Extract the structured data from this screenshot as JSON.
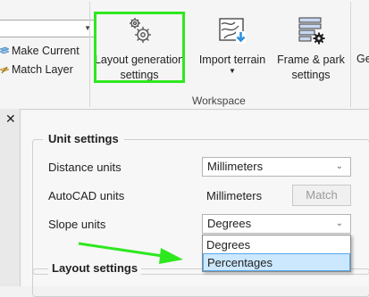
{
  "ribbon": {
    "make_current": "Make Current",
    "match_layer": "Match Layer",
    "layout_generation_line1": "Layout generation",
    "layout_generation_line2": "settings",
    "import_terrain": "Import terrain",
    "frame_park_line1": "Frame & park",
    "frame_park_line2": "settings",
    "cut_label": "Ge",
    "group_label": "Workspace"
  },
  "palette": {
    "close": "✕",
    "unit_settings_title": "Unit settings",
    "distance_units_label": "Distance units",
    "distance_units_value": "Millimeters",
    "autocad_units_label": "AutoCAD units",
    "autocad_units_value": "Millimeters",
    "match_button": "Match",
    "slope_units_label": "Slope units",
    "slope_units_value": "Degrees",
    "slope_options": [
      "Degrees",
      "Percentages"
    ],
    "slope_highlighted": "Percentages",
    "layout_settings_title": "Layout settings"
  },
  "colors": {
    "highlight_green": "#2ee81f",
    "dropdown_selected_bg": "#cce8ff",
    "dropdown_selected_border": "#56a8e8"
  }
}
